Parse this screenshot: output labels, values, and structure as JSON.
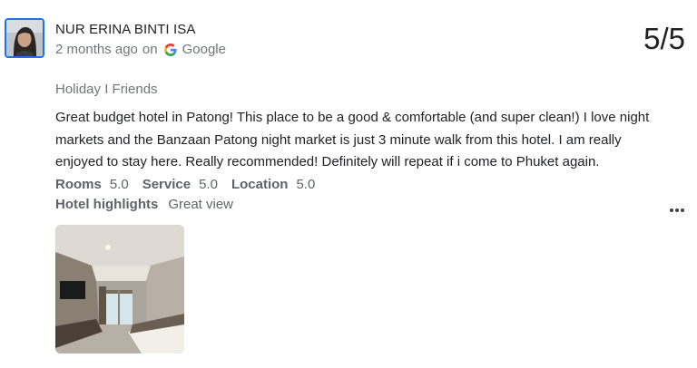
{
  "review": {
    "reviewer_name": "NUR ERINA BINTI ISA",
    "time_ago": "2 months ago",
    "on_word": "on",
    "source": "Google",
    "source_icon": "google-g-icon",
    "rating": "5/5",
    "trip_type": "Holiday I Friends",
    "text": "Great budget hotel in Patong! This place to be a good & comfortable (and super clean!) I love night markets and the Banzaan Patong night market is just 3 minute walk from this hotel. I am really enjoyed to stay here. Really recommended! Definitely will repeat if i come to Phuket again.",
    "sub_ratings": [
      {
        "label": "Rooms",
        "value": "5.0"
      },
      {
        "label": "Service",
        "value": "5.0"
      },
      {
        "label": "Location",
        "value": "5.0"
      }
    ],
    "highlights_label": "Hotel highlights",
    "highlights_value": "Great view",
    "more_icon": "more-horizontal-icon"
  },
  "colors": {
    "avatar_border": "#1a73e8",
    "primary_text": "#202124",
    "secondary_text": "#70757a"
  }
}
